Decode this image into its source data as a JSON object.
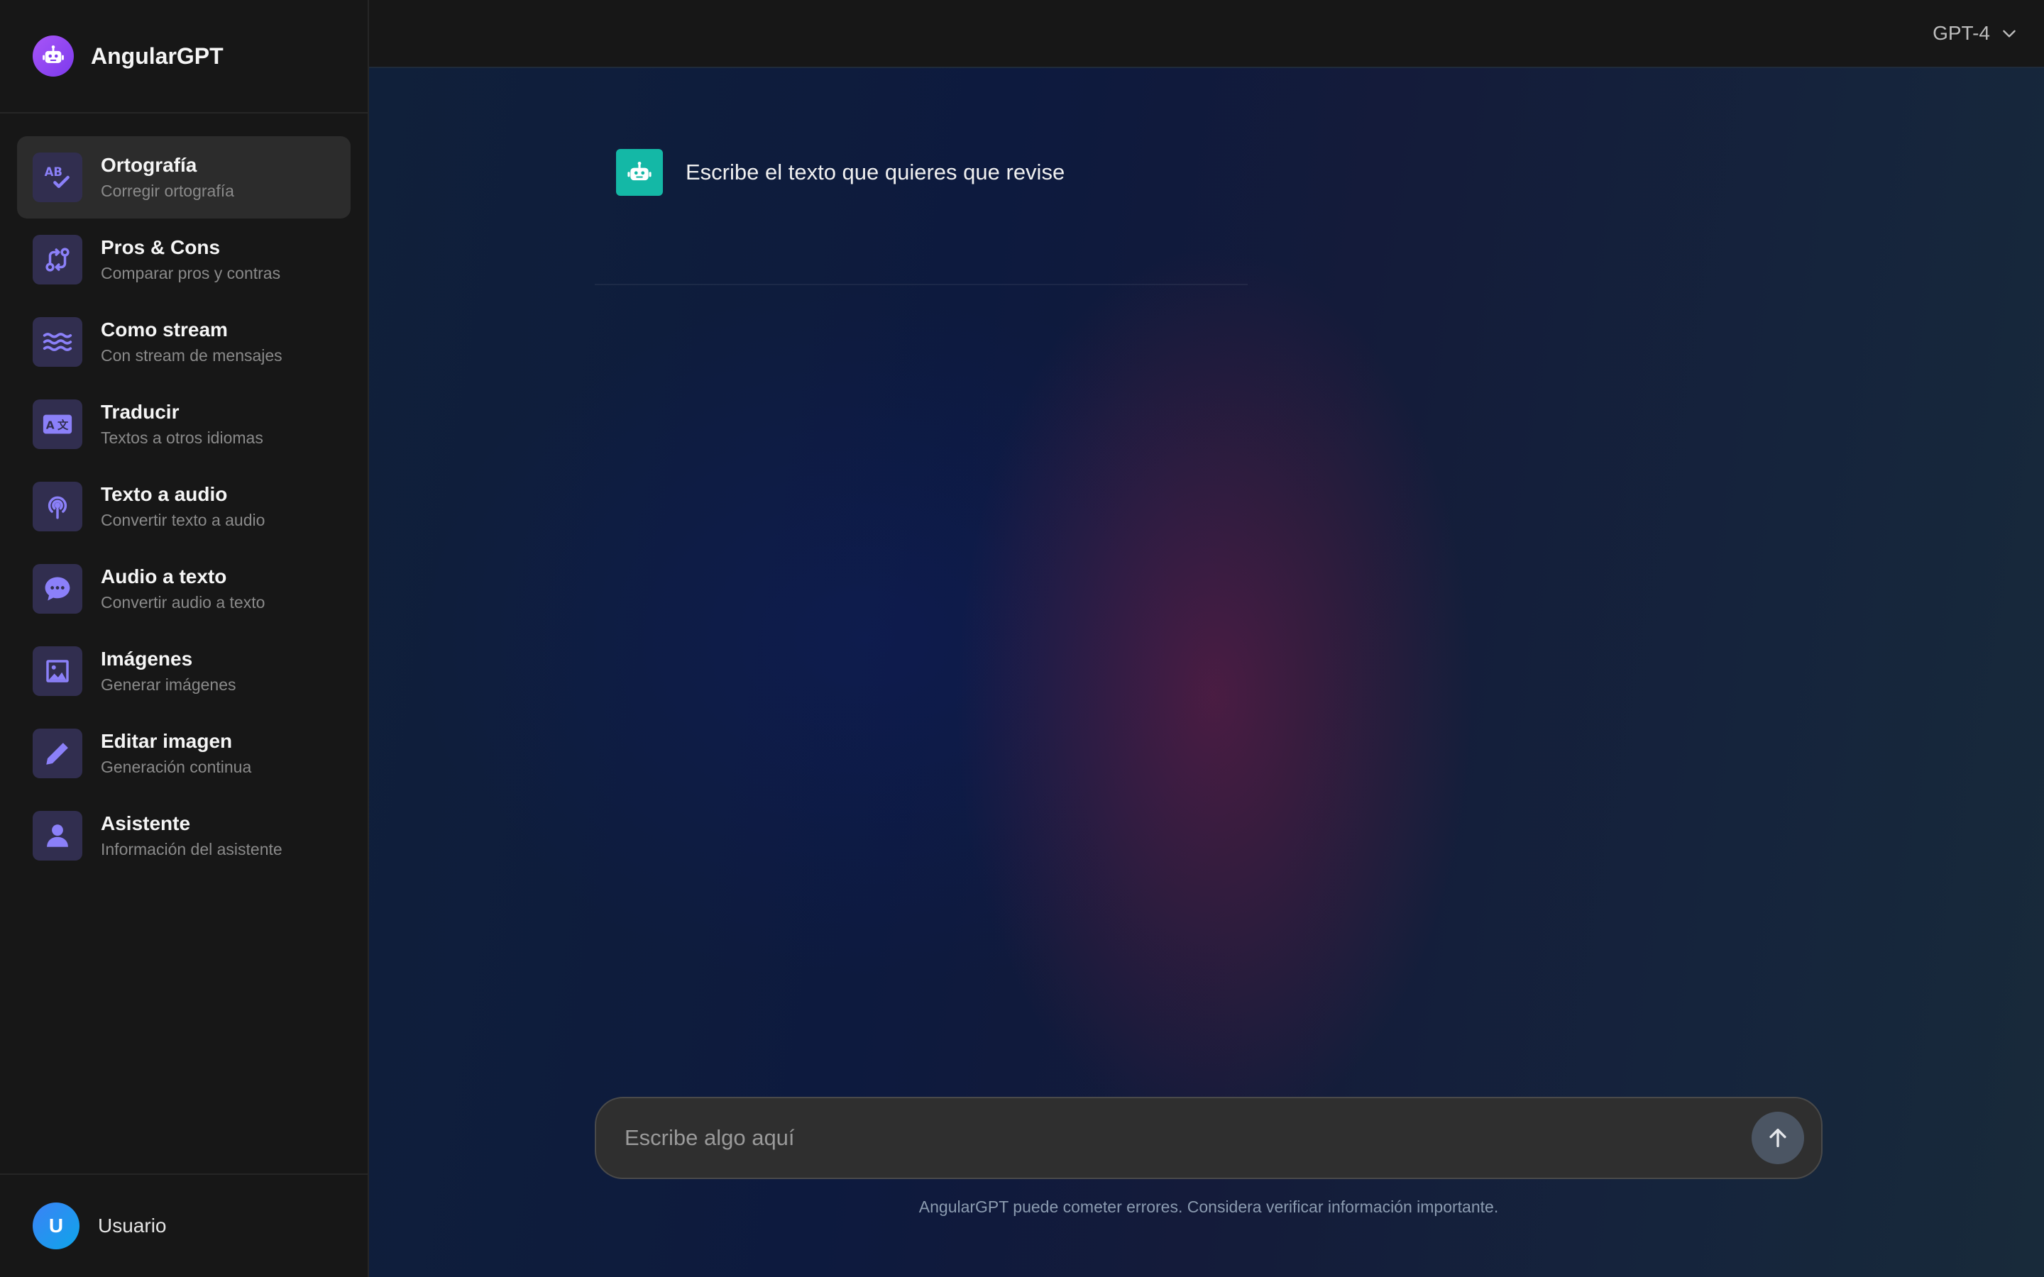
{
  "brand": {
    "title": "AngularGPT"
  },
  "sidebar": {
    "items": [
      {
        "title": "Ortografía",
        "subtitle": "Corregir ortografía",
        "icon": "spellcheck-icon",
        "active": true
      },
      {
        "title": "Pros & Cons",
        "subtitle": "Comparar pros y contras",
        "icon": "compare-arrows-icon"
      },
      {
        "title": "Como stream",
        "subtitle": "Con stream de mensajes",
        "icon": "waves-icon"
      },
      {
        "title": "Traducir",
        "subtitle": "Textos a otros idiomas",
        "icon": "translate-icon"
      },
      {
        "title": "Texto a audio",
        "subtitle": "Convertir texto a audio",
        "icon": "podcast-icon"
      },
      {
        "title": "Audio a texto",
        "subtitle": "Convertir audio a texto",
        "icon": "chat-bubble-icon"
      },
      {
        "title": "Imágenes",
        "subtitle": "Generar imágenes",
        "icon": "image-icon"
      },
      {
        "title": "Editar imagen",
        "subtitle": "Generación continua",
        "icon": "pencil-icon"
      },
      {
        "title": "Asistente",
        "subtitle": "Información del asistente",
        "icon": "person-icon"
      }
    ]
  },
  "user": {
    "initial": "U",
    "name": "Usuario"
  },
  "header": {
    "model": "GPT-4"
  },
  "chat": {
    "messages": [
      {
        "sender": "bot",
        "text": "Escribe el texto que quieres que revise"
      }
    ]
  },
  "composer": {
    "placeholder": "Escribe algo aquí",
    "value": ""
  },
  "footer": {
    "disclaimer": "AngularGPT puede cometer errores. Considera verificar información importante."
  },
  "colors": {
    "accent": "#7c6cf0",
    "bot": "#14b8a6",
    "brand": "#9b5cf6",
    "avatar": "#2f8af5"
  }
}
